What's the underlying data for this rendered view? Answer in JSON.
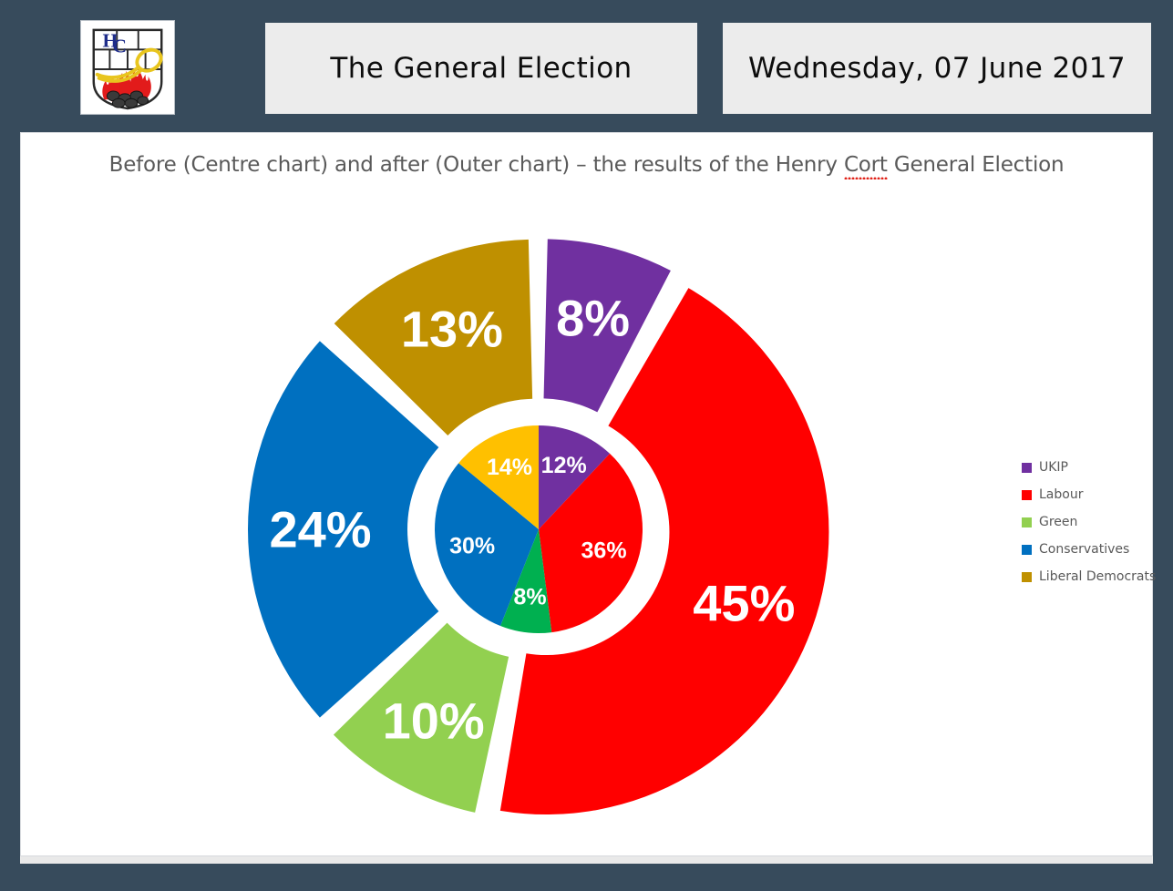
{
  "header": {
    "title": "The General Election",
    "date": "Wednesday, 07 June 2017",
    "logo_alt": "henry-cort-crest"
  },
  "panel": {
    "subtitle_before": "Before (Centre chart) and after (Outer chart) – the results of the Henry ",
    "subtitle_misspelled": "Cort",
    "subtitle_after": " General Election"
  },
  "legend": {
    "items": [
      {
        "label": "UKIP",
        "color": "#7030A0"
      },
      {
        "label": "Labour",
        "color": "#FF0000"
      },
      {
        "label": "Green",
        "color": "#92D050"
      },
      {
        "label": "Conservatives",
        "color": "#0070C0"
      },
      {
        "label": "Liberal Democrats",
        "color": "#BF9000"
      }
    ]
  },
  "chart_data": {
    "type": "pie",
    "title": "Before (Centre chart) and after (Outer chart) – the results of the Henry Cort General Election",
    "categories": [
      "UKIP",
      "Labour",
      "Green",
      "Conservatives",
      "Liberal Democrats"
    ],
    "legend_position": "right",
    "series": [
      {
        "name": "Before (Centre chart)",
        "ring": "inner",
        "values": [
          12,
          36,
          8,
          30,
          14
        ],
        "labels": [
          "12%",
          "36%",
          "8%",
          "30%",
          "14%"
        ],
        "colors": [
          "#7030A0",
          "#FF0000",
          "#00B050",
          "#0070C0",
          "#FFC000"
        ]
      },
      {
        "name": "After (Outer chart)",
        "ring": "outer",
        "values": [
          8,
          45,
          10,
          24,
          13
        ],
        "labels": [
          "8%",
          "45%",
          "10%",
          "24%",
          "13%"
        ],
        "colors": [
          "#7030A0",
          "#FF0000",
          "#92D050",
          "#0070C0",
          "#BF9000"
        ],
        "exploded": true
      }
    ]
  },
  "colors": {
    "background": "#374b5c",
    "panel": "#ffffff",
    "header_box": "#ececec",
    "subtitle_text": "#5a5a5a",
    "spellcheck_underline": "#e2231a"
  }
}
